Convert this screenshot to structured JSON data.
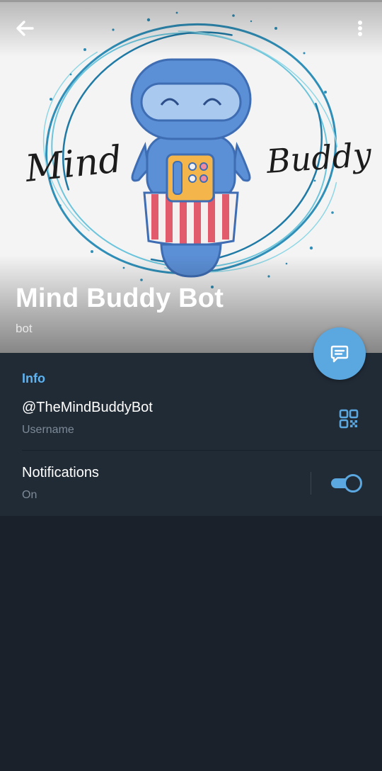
{
  "header": {
    "name": "Mind Buddy Bot",
    "status": "bot",
    "logo_left_text": "Mind",
    "logo_right_text": "Buddy"
  },
  "icons": {
    "back": "arrow-left-icon",
    "menu": "more-vertical-icon",
    "message": "message-icon",
    "qr": "qr-code-icon"
  },
  "info": {
    "section_title": "Info",
    "username": "@TheMindBuddyBot",
    "username_label": "Username",
    "notifications_title": "Notifications",
    "notifications_value": "On",
    "notifications_enabled": true
  },
  "colors": {
    "accent": "#5ba7e0",
    "section_title": "#5fb3f0",
    "background": "#1a212b",
    "card": "#212b36"
  }
}
